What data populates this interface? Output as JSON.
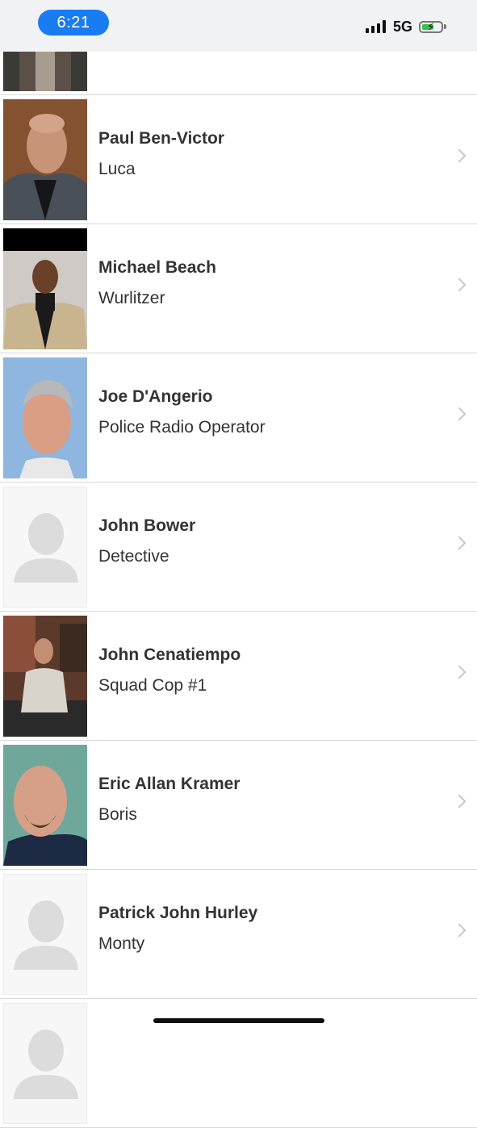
{
  "status_bar": {
    "time": "6:21",
    "network": "5G",
    "battery_level": 0.55,
    "accent": "#1a7cf2"
  },
  "cast": [
    {
      "actor": "",
      "role": "",
      "photo": "partial-top"
    },
    {
      "actor": "Paul Ben-Victor",
      "role": "Luca",
      "photo": "bald-dark-jacket"
    },
    {
      "actor": "Michael Beach",
      "role": "Wurlitzer",
      "photo": "tan-blazer-banner"
    },
    {
      "actor": "Joe D'Angerio",
      "role": "Police Radio Operator",
      "photo": "gray-hair-sky"
    },
    {
      "actor": "John Bower",
      "role": "Detective",
      "photo": "placeholder-silhouette"
    },
    {
      "actor": "John Cenatiempo",
      "role": "Squad Cop #1",
      "photo": "gym-gray-shirt"
    },
    {
      "actor": "Eric Allan Kramer",
      "role": "Boris",
      "photo": "bald-goatee-teal"
    },
    {
      "actor": "Patrick John Hurley",
      "role": "Monty",
      "photo": "placeholder-silhouette"
    },
    {
      "actor": "",
      "role": "",
      "photo": "placeholder-silhouette"
    }
  ]
}
